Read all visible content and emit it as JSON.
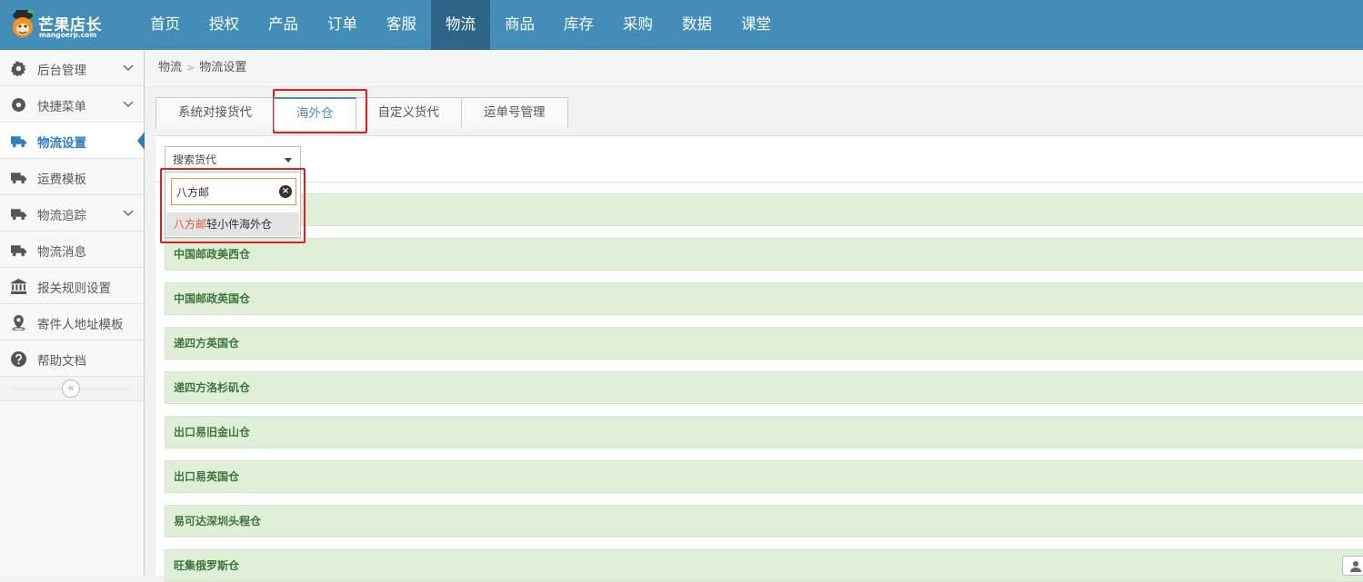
{
  "logo": {
    "brand": "芒果店长",
    "domain": "mangoerp.com"
  },
  "nav": [
    {
      "label": "首页"
    },
    {
      "label": "授权"
    },
    {
      "label": "产品"
    },
    {
      "label": "订单"
    },
    {
      "label": "客服"
    },
    {
      "label": "物流"
    },
    {
      "label": "商品"
    },
    {
      "label": "库存"
    },
    {
      "label": "采购"
    },
    {
      "label": "数据"
    },
    {
      "label": "课堂"
    }
  ],
  "nav_active": "物流",
  "sidebar": {
    "items": [
      {
        "label": "后台管理",
        "icon": "gear-icon",
        "expandable": true
      },
      {
        "label": "快捷菜单",
        "icon": "disc-icon",
        "expandable": true
      },
      {
        "label": "物流设置",
        "icon": "truck-icon",
        "active": true
      },
      {
        "label": "运费模板",
        "icon": "truck-icon"
      },
      {
        "label": "物流追踪",
        "icon": "truck-icon",
        "expandable": true
      },
      {
        "label": "物流消息",
        "icon": "truck-icon"
      },
      {
        "label": "报关规则设置",
        "icon": "bank-icon"
      },
      {
        "label": "寄件人地址模板",
        "icon": "map-pin-icon"
      },
      {
        "label": "帮助文档",
        "icon": "question-icon"
      }
    ],
    "collapse_glyph": "«"
  },
  "breadcrumb": {
    "root": "物流",
    "current": "物流设置"
  },
  "tabs": [
    {
      "label": "系统对接货代"
    },
    {
      "label": "海外仓",
      "active": true
    },
    {
      "label": "自定义货代"
    },
    {
      "label": "运单号管理"
    }
  ],
  "search_select": {
    "selected": "搜索货代",
    "input_value": "八方邮",
    "result_match": "八方邮",
    "result_rest": "轻小件海外仓"
  },
  "warehouses": [
    "八方邮轻小件海外仓",
    "中国邮政美西仓",
    "中国邮政英国仓",
    "递四方英国仓",
    "递四方洛杉矶仓",
    "出口易旧金山仓",
    "出口易英国仓",
    "易可达深圳头程仓",
    "旺集俄罗斯仓"
  ],
  "colors": {
    "nav_bg": "#438eb9",
    "nav_active": "#2e6589",
    "row_bg": "#e0efd8",
    "row_text": "#3c763d",
    "highlight": "#e02020"
  }
}
